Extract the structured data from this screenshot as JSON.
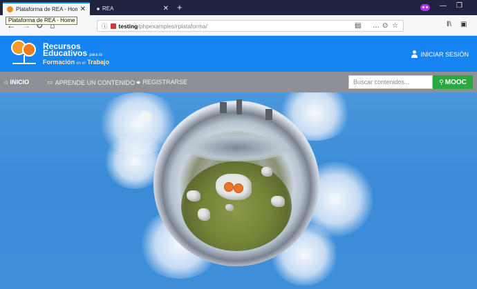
{
  "browser": {
    "tabs": [
      {
        "title": "Plataforma de REA - Home",
        "active": true
      },
      {
        "title": "REA",
        "active": false
      }
    ],
    "tooltip": "Plataforma de REA - Home",
    "url": {
      "host": "testing",
      "path": "/phpexamples/rplataforma/"
    }
  },
  "site": {
    "logo": {
      "line1": "Recursos",
      "line2": "Educativos",
      "para": "para la",
      "line3": "Formación",
      "al": "en el",
      "line3b": "Trabajo"
    },
    "login_label": "INICIAR SESIÓN",
    "nav": {
      "items": [
        {
          "label": "INICIO",
          "icon": "home-icon"
        },
        {
          "label": "APRENDE UN CONTENIDO",
          "icon": "chat-icon",
          "dropdown": true
        },
        {
          "label": "REGISTRARSE",
          "icon": "info-icon"
        }
      ],
      "search_placeholder": "Buscar contenidos...",
      "mooc_label": "MOOC"
    }
  },
  "colors": {
    "header_blue": "#1684f1",
    "nav_gray": "#8e9097",
    "mooc_green": "#2aa844",
    "logo_orange": "#f39a2b"
  }
}
